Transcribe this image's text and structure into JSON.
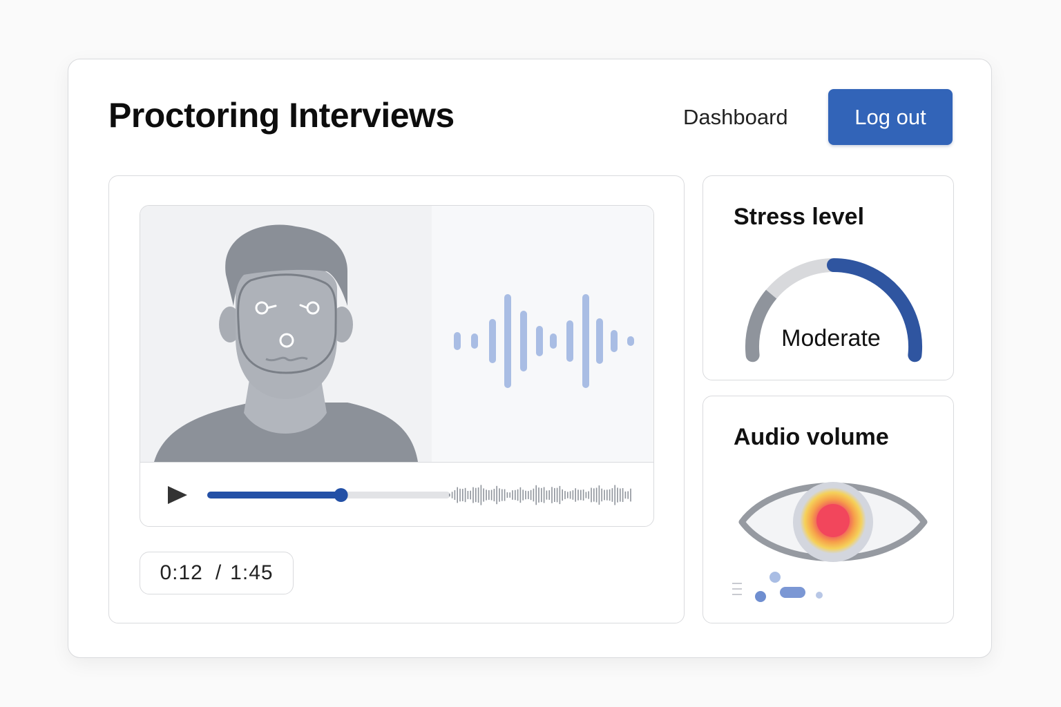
{
  "header": {
    "title": "Proctoring Interviews",
    "nav_dashboard": "Dashboard",
    "logout_label": "Log out"
  },
  "player": {
    "progress": 0.55,
    "current_time": "0:12",
    "separator": "/",
    "total_time": "1:45"
  },
  "stress": {
    "title": "Stress level",
    "value_label": "Moderate",
    "level": 0.5
  },
  "audio": {
    "title": "Audio volume"
  },
  "colors": {
    "accent": "#3264b8",
    "progress": "#2350a6",
    "gauge_blue": "#2f55a0",
    "gauge_gray": "#8f949c",
    "gauge_light": "#d8d9dc",
    "wave": "#a9bde4",
    "heat_core": "#f2465c",
    "heat_mid": "#f6a04a",
    "heat_outer": "#f5d15a"
  },
  "icons": {
    "play": "play-icon",
    "eye": "eye-icon"
  }
}
